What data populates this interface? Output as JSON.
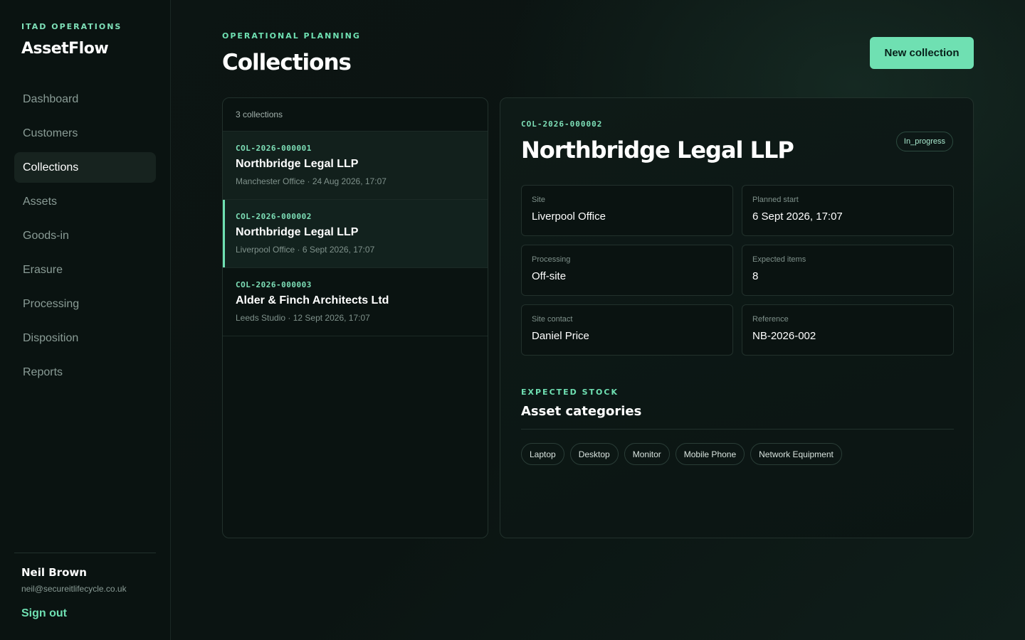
{
  "sidebar": {
    "eyebrow": "ITAD OPERATIONS",
    "brand": "AssetFlow",
    "nav": [
      {
        "label": "Dashboard",
        "active": false
      },
      {
        "label": "Customers",
        "active": false
      },
      {
        "label": "Collections",
        "active": true
      },
      {
        "label": "Assets",
        "active": false
      },
      {
        "label": "Goods-in",
        "active": false
      },
      {
        "label": "Erasure",
        "active": false
      },
      {
        "label": "Processing",
        "active": false
      },
      {
        "label": "Disposition",
        "active": false
      },
      {
        "label": "Reports",
        "active": false
      }
    ],
    "user": {
      "name": "Neil Brown",
      "email": "neil@secureitlifecycle.co.uk",
      "sign_out": "Sign out"
    }
  },
  "header": {
    "eyebrow": "OPERATIONAL PLANNING",
    "title": "Collections",
    "new_button": "New collection"
  },
  "list": {
    "count": "3 collections",
    "items": [
      {
        "code": "COL-2026-000001",
        "name": "Northbridge Legal LLP",
        "meta": "Manchester Office · 24 Aug 2026, 17:07"
      },
      {
        "code": "COL-2026-000002",
        "name": "Northbridge Legal LLP",
        "meta": "Liverpool Office · 6 Sept 2026, 17:07",
        "selected": true
      },
      {
        "code": "COL-2026-000003",
        "name": "Alder & Finch Architects Ltd",
        "meta": "Leeds Studio · 12 Sept 2026, 17:07"
      }
    ]
  },
  "detail": {
    "code": "COL-2026-000002",
    "title": "Northbridge Legal LLP",
    "status": "In_progress",
    "fields": {
      "site": {
        "label": "Site",
        "value": "Liverpool Office"
      },
      "planned_start": {
        "label": "Planned start",
        "value": "6 Sept 2026, 17:07"
      },
      "processing": {
        "label": "Processing",
        "value": "Off-site"
      },
      "expected_items": {
        "label": "Expected items",
        "value": "8"
      },
      "site_contact": {
        "label": "Site contact",
        "value": "Daniel Price"
      },
      "reference": {
        "label": "Reference",
        "value": "NB-2026-002"
      }
    },
    "stock": {
      "eyebrow": "EXPECTED STOCK",
      "title": "Asset categories",
      "categories": [
        "Laptop",
        "Desktop",
        "Monitor",
        "Mobile Phone",
        "Network Equipment"
      ]
    }
  },
  "colors": {
    "accent": "#6fe0b2",
    "background": "#0b1412",
    "panel": "#0a1311"
  }
}
